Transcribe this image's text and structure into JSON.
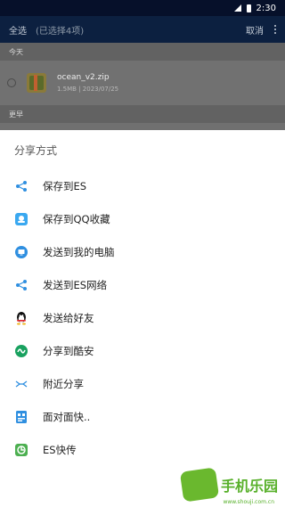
{
  "status_bar": {
    "time": "2:30"
  },
  "action_bar": {
    "select_all": "全选",
    "selected_count": "(已选择4项)",
    "cancel": "取消"
  },
  "file_list": {
    "section_today": "今天",
    "file": {
      "name": "ocean_v2.zip",
      "meta": "1.5MB | 2023/07/25"
    },
    "section_earlier": "更早"
  },
  "share_sheet": {
    "title": "分享方式",
    "items": [
      {
        "label": "保存到ES",
        "icon": "share-nodes-icon"
      },
      {
        "label": "保存到QQ收藏",
        "icon": "qq-favorites-icon"
      },
      {
        "label": "发送到我的电脑",
        "icon": "monitor-icon"
      },
      {
        "label": "发送到ES网络",
        "icon": "share-nodes-icon"
      },
      {
        "label": "发送给好友",
        "icon": "qq-penguin-icon"
      },
      {
        "label": "分享到酷安",
        "icon": "coolapk-icon"
      },
      {
        "label": "附近分享",
        "icon": "nearby-icon"
      },
      {
        "label": "面对面快..",
        "icon": "face-to-face-icon"
      },
      {
        "label": "ES快传",
        "icon": "es-transfer-icon"
      }
    ]
  },
  "watermark": {
    "text": "手机乐园",
    "sub": "www.shouji.com.cn"
  },
  "colors": {
    "accent": "#2f8fe0",
    "status_bar": "#06102a",
    "sheet_bg": "#ffffff"
  }
}
